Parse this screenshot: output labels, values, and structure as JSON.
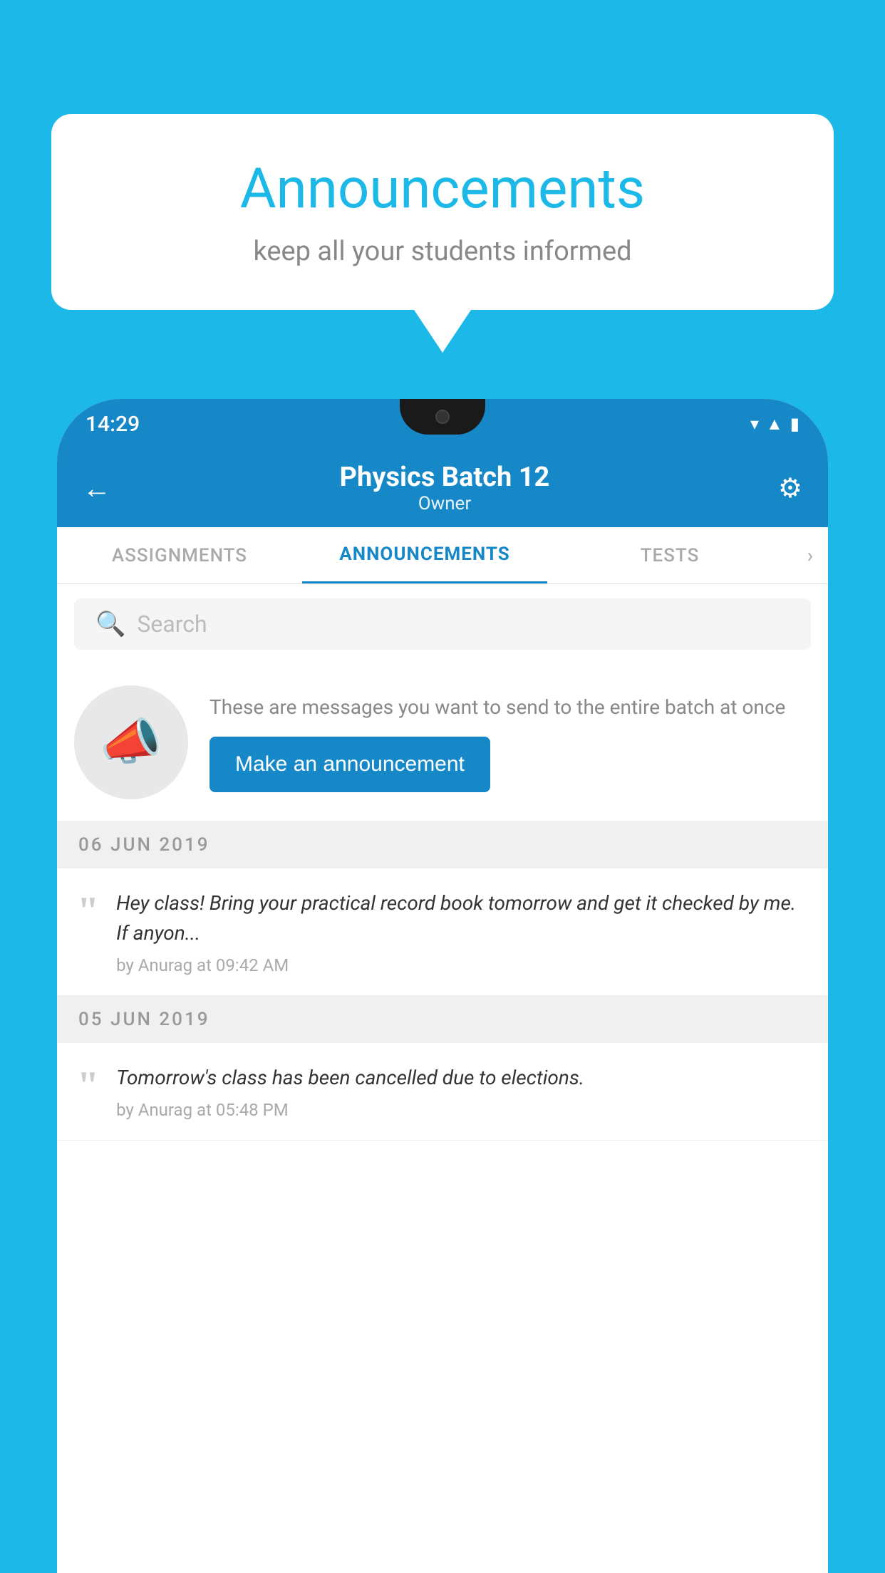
{
  "background_color": "#1BB8E8",
  "speech_bubble": {
    "title": "Announcements",
    "subtitle": "keep all your students informed"
  },
  "status_bar": {
    "time": "14:29",
    "icons": [
      "wifi",
      "signal",
      "battery"
    ]
  },
  "header": {
    "title": "Physics Batch 12",
    "subtitle": "Owner",
    "back_label": "←",
    "gear_label": "⚙"
  },
  "tabs": [
    {
      "label": "ASSIGNMENTS",
      "active": false
    },
    {
      "label": "ANNOUNCEMENTS",
      "active": true
    },
    {
      "label": "TESTS",
      "active": false
    }
  ],
  "search": {
    "placeholder": "Search"
  },
  "announcement_prompt": {
    "description": "These are messages you want to send to the entire batch at once",
    "button_label": "Make an announcement"
  },
  "date_groups": [
    {
      "date": "06  JUN  2019",
      "items": [
        {
          "message": "Hey class! Bring your practical record book tomorrow and get it checked by me. If anyon...",
          "meta": "by Anurag at 09:42 AM"
        }
      ]
    },
    {
      "date": "05  JUN  2019",
      "items": [
        {
          "message": "Tomorrow's class has been cancelled due to elections.",
          "meta": "by Anurag at 05:48 PM"
        }
      ]
    }
  ]
}
